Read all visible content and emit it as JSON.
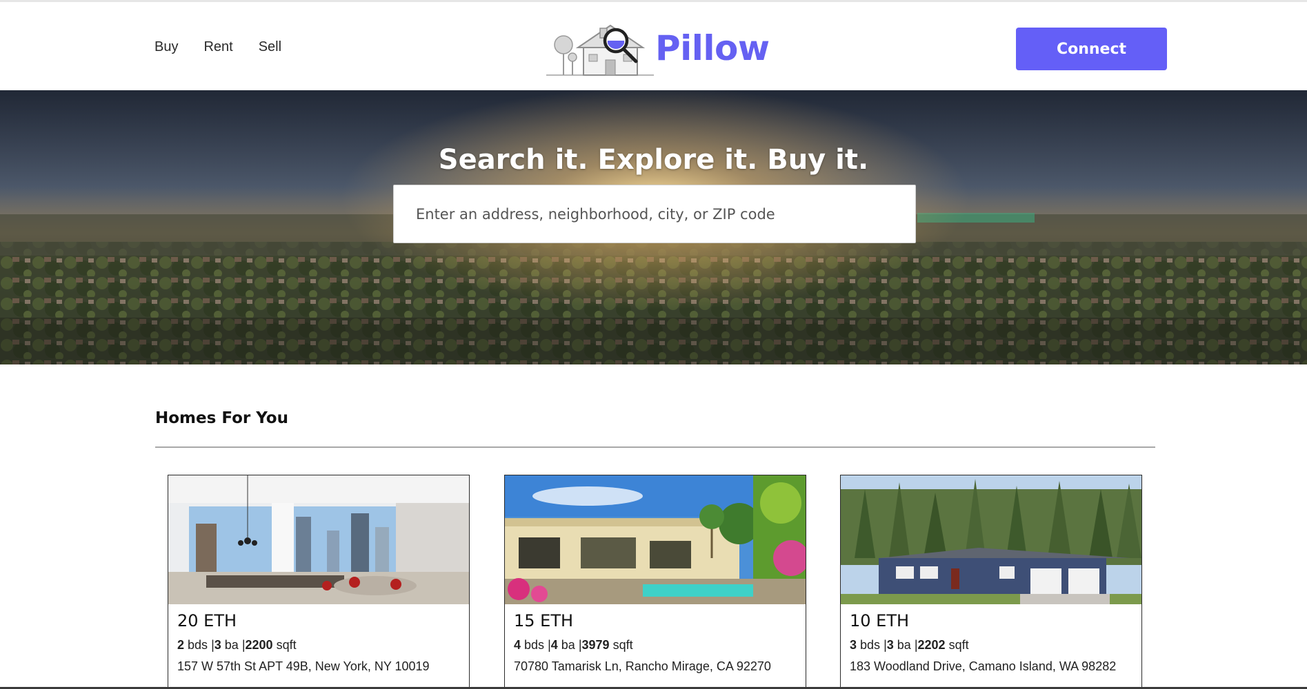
{
  "nav": {
    "items": [
      {
        "label": "Buy"
      },
      {
        "label": "Rent"
      },
      {
        "label": "Sell"
      }
    ]
  },
  "brand": {
    "name": "Pillow",
    "logo_icon": "house-magnifier-icon",
    "color": "#6561f2"
  },
  "connect_button": {
    "label": "Connect",
    "color": "#645ff7"
  },
  "hero": {
    "title": "Search it. Explore it. Buy it.",
    "search_placeholder": "Enter an address, neighborhood, city, or ZIP code",
    "search_value": ""
  },
  "homes": {
    "title": "Homes For You",
    "cards": [
      {
        "price": "20 ETH",
        "beds": "2",
        "beds_unit": "bds",
        "baths": "3",
        "baths_unit": "ba",
        "sqft": "2200",
        "sqft_unit": "sqft",
        "address": "157 W 57th St APT 49B, New York, NY 10019"
      },
      {
        "price": "15 ETH",
        "beds": "4",
        "beds_unit": "bds",
        "baths": "4",
        "baths_unit": "ba",
        "sqft": "3979",
        "sqft_unit": "sqft",
        "address": "70780 Tamarisk Ln, Rancho Mirage, CA 92270"
      },
      {
        "price": "10 ETH",
        "beds": "3",
        "beds_unit": "bds",
        "baths": "3",
        "baths_unit": "ba",
        "sqft": "2202",
        "sqft_unit": "sqft",
        "address": "183 Woodland Drive, Camano Island, WA 98282"
      }
    ]
  }
}
